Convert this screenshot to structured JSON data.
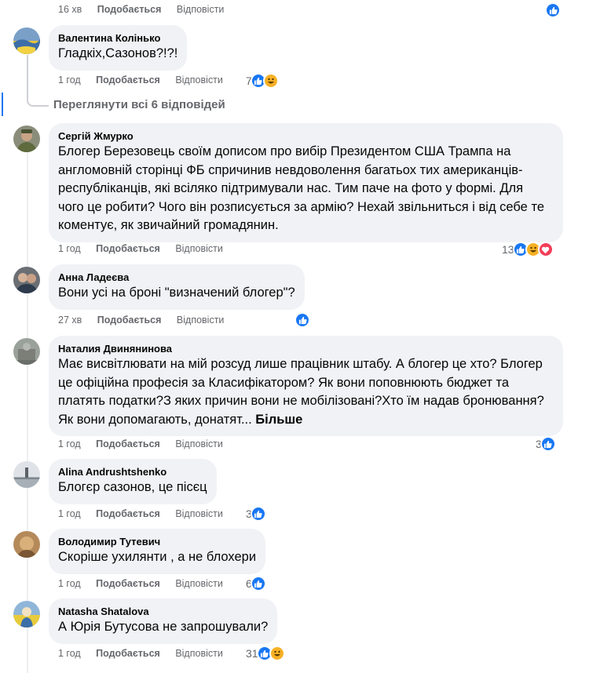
{
  "top_meta": {
    "time": "16 хв",
    "like": "Подобається",
    "reply": "Відповісти"
  },
  "view_all": "Переглянути всі 6 відповідей",
  "comments": [
    {
      "author": "Валентина Колінько",
      "text": "Гладкіх,Сазонов?!?!",
      "time": "1 год",
      "like": "Подобається",
      "reply": "Відповісти",
      "count": "7",
      "reactions": [
        "like",
        "haha"
      ]
    },
    {
      "author": "Сергій Жмурко",
      "text": "Блогер Березовець своїм дописом про вибір Президентом США Трампа на\nангломовній сторінці ФБ спричинив невдоволення багатьох тих американців-\nреспубліканців, які всіляко підтримували нас. Тим паче на фото у формі. Для\nчого це робити? Чого він розписується за армію? Нехай звільниться і від себе те\nкоментує, як звичайний громадянин.",
      "time": "1 год",
      "like": "Подобається",
      "reply": "Відповісти",
      "count": "13",
      "reactions": [
        "like",
        "haha",
        "love"
      ]
    },
    {
      "author": "Анна Ладеєва",
      "text": "Вони усі на броні \"визначений блогер\"?",
      "time": "27 хв",
      "like": "Подобається",
      "reply": "Відповісти",
      "count": "",
      "reactions": [
        "like"
      ]
    },
    {
      "author": "Наталия Двинянинова",
      "text": "Має висвітлювати на мій розсуд лише працівник штабу. А блогер це хто? Блогер\nце офіційна професія за Класифікатором? Як вони поповнюють бюджет та\nплатять податки?З яких причин вони не мобілізовані?Хто їм надав бронювання?\nЯк вони допомагають, донатят... ",
      "more": "Більше",
      "time": "1 год",
      "like": "Подобається",
      "reply": "Відповісти",
      "count": "3",
      "reactions": [
        "like"
      ]
    },
    {
      "author": "Alina Andrushtshenko",
      "text": "Блогєр сазонов, це пісєц",
      "time": "1 год",
      "like": "Подобається",
      "reply": "Відповісти",
      "count": "3",
      "reactions": [
        "like"
      ]
    },
    {
      "author": "Володимир Тутевич",
      "text": "Скоріше ухилянти , а не блохери",
      "time": "1 год",
      "like": "Подобається",
      "reply": "Відповісти",
      "count": "6",
      "reactions": [
        "like"
      ]
    },
    {
      "author": "Natasha Shatalova",
      "text": "А Юрія Бутусова не запрошували?",
      "time": "1 год",
      "like": "Подобається",
      "reply": "Відповісти",
      "count": "31",
      "reactions": [
        "like",
        "haha"
      ]
    }
  ],
  "colors": {
    "like": "#1877f2",
    "haha": "#f7b125",
    "love": "#f33e58",
    "bubble": "#f0f2f5",
    "meta": "#65676b"
  }
}
